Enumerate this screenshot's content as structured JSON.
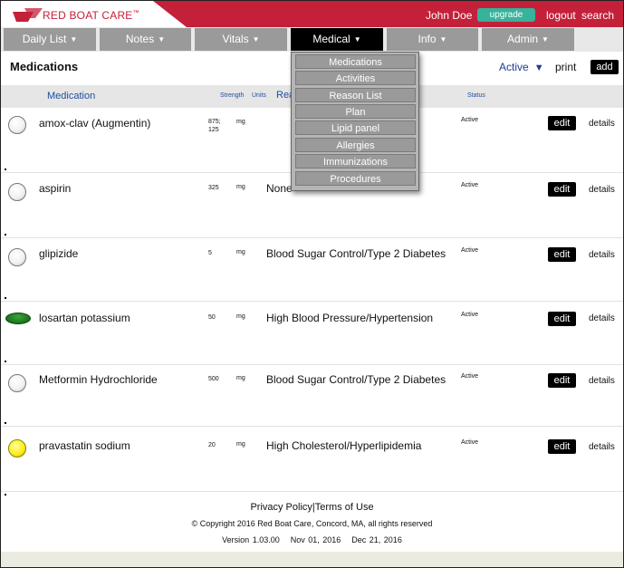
{
  "header": {
    "brand": "RED BOAT CARE",
    "brand_tm": "™",
    "user_name": "John Doe",
    "upgrade_label": "upgrade",
    "logout_label": "logout",
    "search_label": "search",
    "colors": {
      "header": "#c4203a",
      "upgrade": "#36b39a"
    }
  },
  "nav": {
    "tabs": [
      {
        "label": "Daily List"
      },
      {
        "label": "Notes"
      },
      {
        "label": "Vitals"
      },
      {
        "label": "Medical"
      },
      {
        "label": "Info"
      },
      {
        "label": "Admin"
      }
    ],
    "active_tab": "Medical",
    "caret": "▼"
  },
  "page": {
    "title": "Medications",
    "filter_value": "Active",
    "filter_caret": "▼",
    "print_label": "print",
    "add_label": "add"
  },
  "table": {
    "headers": {
      "medication": "Medication",
      "strength": "Strength",
      "units": "Units",
      "reason": "Reason",
      "status": "Status"
    },
    "rows": [
      {
        "pill": "white-round",
        "name": "amox-clav (Augmentin)",
        "strength": "875;\n125",
        "units": "mg",
        "reason": "",
        "status": "Active",
        "edit": "edit",
        "details": "details"
      },
      {
        "pill": "white-round",
        "name": "aspirin",
        "strength": "325",
        "units": "mg",
        "reason": "None",
        "status": "Active",
        "edit": "edit",
        "details": "details"
      },
      {
        "pill": "white-round",
        "name": "glipizide",
        "strength": "5",
        "units": "mg",
        "reason": "Blood Sugar Control/Type 2 Diabetes",
        "status": "Active",
        "edit": "edit",
        "details": "details"
      },
      {
        "pill": "green-oval",
        "name": "losartan potassium",
        "strength": "50",
        "units": "mg",
        "reason": "High Blood Pressure/Hypertension",
        "status": "Active",
        "edit": "edit",
        "details": "details"
      },
      {
        "pill": "white-round",
        "name": "Metformin Hydrochloride",
        "strength": "500",
        "units": "mg",
        "reason": "Blood Sugar Control/Type 2 Diabetes",
        "status": "Active",
        "edit": "edit",
        "details": "details"
      },
      {
        "pill": "yellow-round",
        "name": "pravastatin sodium",
        "strength": "20",
        "units": "mg",
        "reason": "High Cholesterol/Hyperlipidemia",
        "status": "Active",
        "edit": "edit",
        "details": "details"
      }
    ]
  },
  "medical_menu": {
    "items": [
      "Medications",
      "Activities",
      "Reason List",
      "Plan",
      "Lipid panel",
      "Allergies",
      "Immunizations",
      "Procedures"
    ]
  },
  "footer": {
    "privacy": "Privacy Policy",
    "separator": "|",
    "terms": "Terms of Use",
    "copyright": "© Copyright 2016 Red Boat Care, Concord, MA, all rights reserved",
    "version": "Version 1.03.00",
    "date1": "Nov 01, 2016",
    "date2": "Dec 21, 2016"
  }
}
